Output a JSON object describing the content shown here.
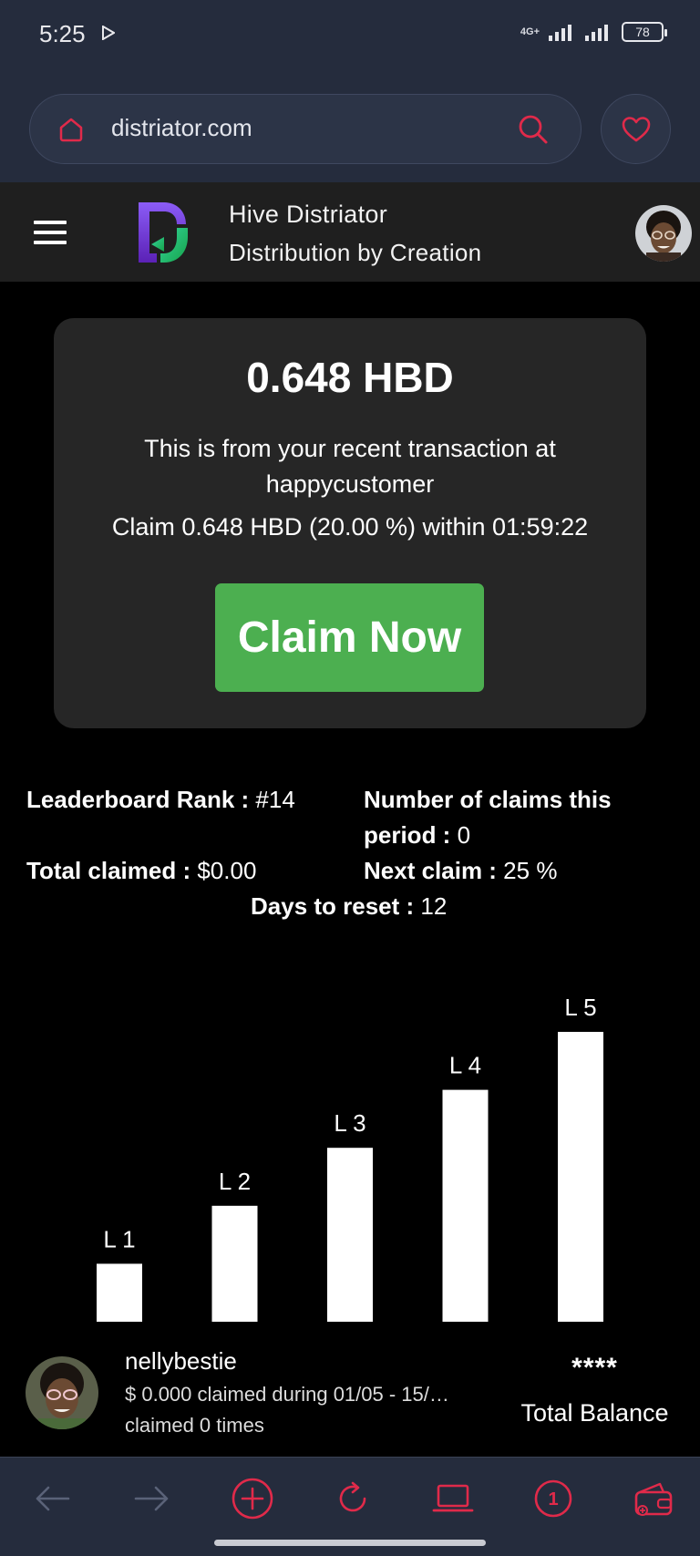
{
  "status_bar": {
    "time": "5:25",
    "network": "4G+",
    "battery": "78"
  },
  "browser": {
    "url": "distriator.com",
    "icons": [
      "home-icon",
      "search-icon",
      "heart-icon"
    ]
  },
  "header": {
    "title": "Hive Distriator",
    "subtitle": "Distribution by Creation"
  },
  "claim_card": {
    "amount": "0.648 HBD",
    "description": "This is from your recent transaction at happycustomer",
    "detail": "Claim 0.648 HBD (20.00 %) within  01:59:22",
    "button_label": "Claim Now",
    "button_color": "#4caf50"
  },
  "stats": {
    "rank_label": "Leaderboard Rank : ",
    "rank_value": "#14",
    "claims_label_line1": "Number of claims this",
    "claims_label_line2": "period : ",
    "claims_value": "0",
    "total_label": "Total claimed : ",
    "total_value": "$0.00",
    "next_label": "Next claim : ",
    "next_value": "25 %",
    "reset_label": "Days to reset : ",
    "reset_value": "12"
  },
  "chart_data": {
    "type": "bar",
    "categories": [
      "L 1",
      "L 2",
      "L 3",
      "L 4",
      "L 5"
    ],
    "values": [
      1,
      2,
      3,
      4,
      5
    ],
    "title": "",
    "xlabel": "",
    "ylabel": "",
    "ylim": [
      0,
      5
    ],
    "grid": false,
    "bar_color": "#ffffff"
  },
  "user": {
    "name": "nellybestie",
    "claimed": "$ 0.000 claimed during 01/05 - 15/…",
    "times": "claimed 0 times",
    "balance_hidden": "****",
    "balance_label": "Total Balance"
  },
  "bottom_nav": {
    "icons": [
      "back-icon",
      "forward-icon",
      "add-icon",
      "reload-icon",
      "laptop-icon",
      "tabs-count-icon",
      "wallet-icon"
    ],
    "tab_count": "1",
    "accent_color": "#e02a4a"
  }
}
